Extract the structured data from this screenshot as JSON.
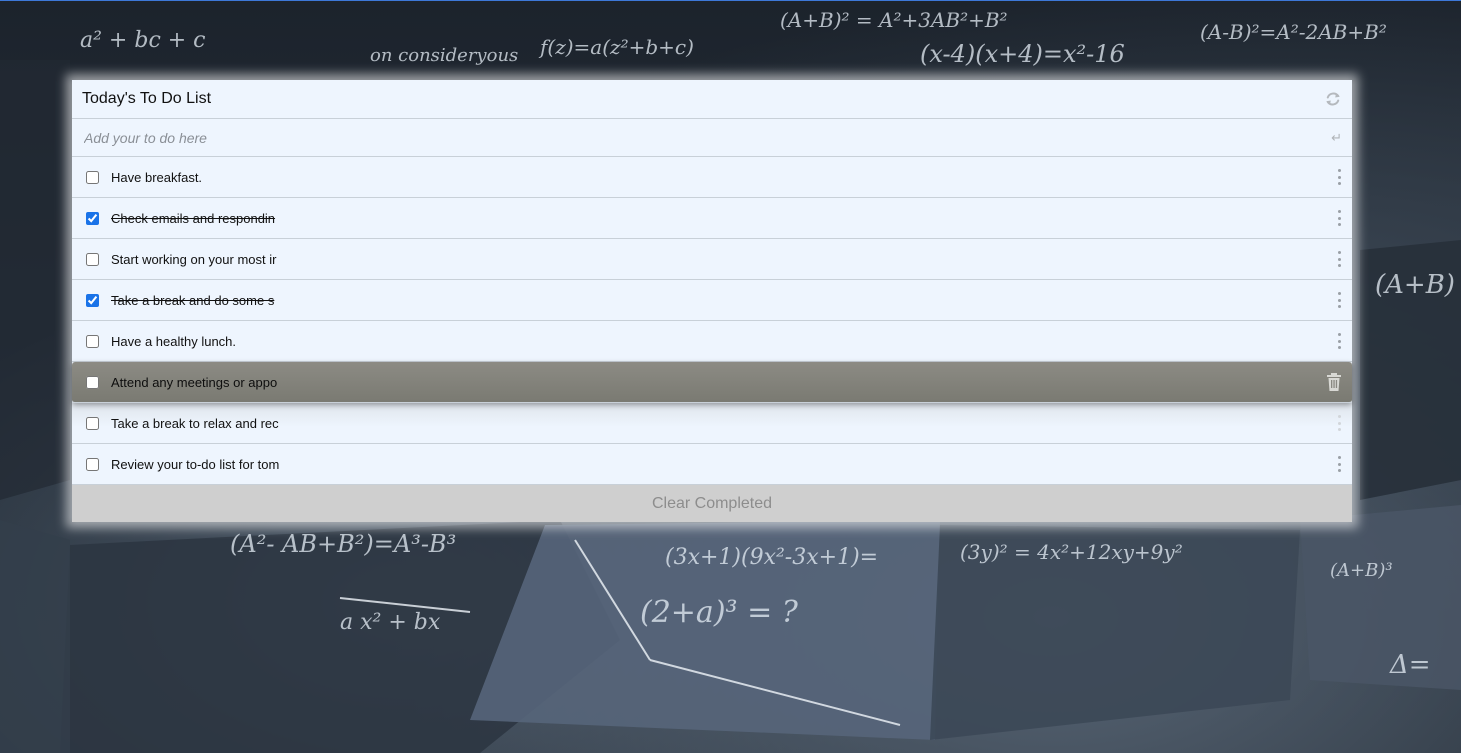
{
  "theme": {
    "accent": "#3d78d8",
    "panel_bg": "#eef5fe",
    "footer_bg": "#cfcfcf",
    "hover_row_bg": "#83827b"
  },
  "header": {
    "title": "Today's To Do List",
    "refresh_icon": "refresh-icon"
  },
  "input": {
    "value": "",
    "placeholder": "Add your to do here",
    "enter_icon": "↵"
  },
  "todos": [
    {
      "text": "Have breakfast.",
      "checked": false
    },
    {
      "text": "Check emails and respondin",
      "checked": true
    },
    {
      "text": "Start working on your most ir",
      "checked": false
    },
    {
      "text": "Take a break and do some s",
      "checked": true
    },
    {
      "text": "Have a healthy lunch.",
      "checked": false
    },
    {
      "text": "Attend any meetings or appo",
      "checked": false
    },
    {
      "text": "Take a break to relax and rec",
      "checked": false
    },
    {
      "text": "Review your to-do list for tom",
      "checked": false
    }
  ],
  "footer": {
    "clear_label": "Clear Completed"
  }
}
